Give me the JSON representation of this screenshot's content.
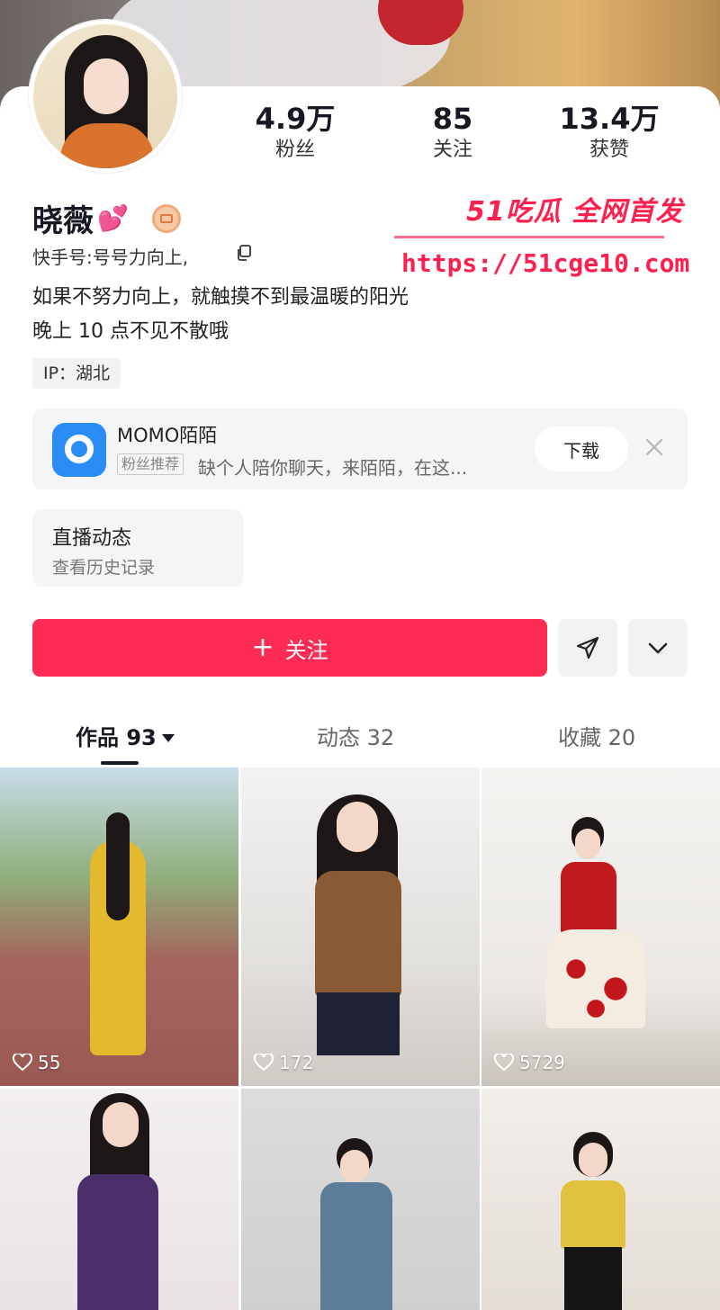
{
  "profile": {
    "name": "晓薇",
    "name_emoji": "💕",
    "kuaishou_id": "快手号:号号力向上,",
    "bio_line_1": "如果不努力向上，就触摸不到最温暖的阳光",
    "bio_line_2": "晚上 10 点不见不散哦",
    "ip_label": "IP：湖北"
  },
  "stats": [
    {
      "value": "4.9万",
      "label": "粉丝"
    },
    {
      "value": "85",
      "label": "关注"
    },
    {
      "value": "13.4万",
      "label": "获赞"
    }
  ],
  "watermark": {
    "title": "51吃瓜 全网首发",
    "url": "https://51cge10.com"
  },
  "ad": {
    "app_name": "MOMO陌陌",
    "tag": "粉丝推荐",
    "description": "缺个人陪你聊天，来陌陌，在这...",
    "download_label": "下载"
  },
  "live": {
    "title": "直播动态",
    "subtitle": "查看历史记录"
  },
  "actions": {
    "follow_label": "关注"
  },
  "tabs": [
    {
      "label": "作品 93",
      "active": true
    },
    {
      "label": "动态 32",
      "active": false
    },
    {
      "label": "收藏 20",
      "active": false
    }
  ],
  "videos": [
    {
      "likes": "55"
    },
    {
      "likes": "172"
    },
    {
      "likes": "5729"
    },
    {
      "likes": ""
    },
    {
      "likes": ""
    },
    {
      "likes": ""
    }
  ],
  "colors": {
    "accent": "#fe2c55",
    "watermark": "#ff1f4f"
  }
}
